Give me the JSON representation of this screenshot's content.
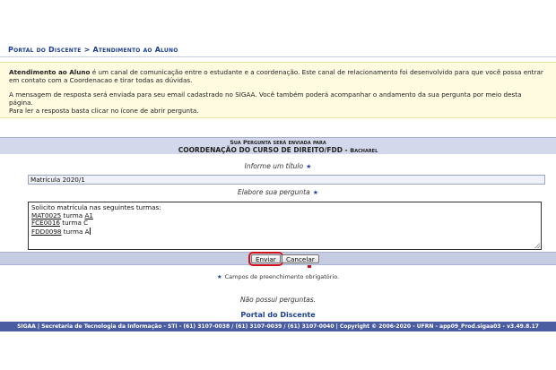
{
  "breadcrumb": {
    "root": "Portal do Discente",
    "separator": ">",
    "current": "Atendimento ao Aluno"
  },
  "info": {
    "lead_bold": "Atendimento ao Aluno",
    "lead_rest": " é um canal de comunicação entre o estudante e a coordenação. Este canal de relacionamento foi desenvolvido para que você possa entrar em contato com a Coordenacao e tirar todas as dúvidas.",
    "line2": "A mensagem de resposta será enviada para seu email cadastrado no SIGAA. Você também poderá acompanhar o andamento da sua pergunta por meio desta página.",
    "line3": "Para ler a resposta basta clicar no ícone de abrir pergunta."
  },
  "form": {
    "header_line1": "Sua Pergunta será enviada para",
    "header_course": "COORDENAÇÃO DO CURSO DE DIREITO/FDD",
    "header_sep": " - ",
    "header_degree": "Bacharel",
    "title_label": "Informe um título",
    "title_value": "Matrícula 2020/1",
    "question_label": "Elabore sua pergunta",
    "required_star": "★",
    "message": {
      "intro": "Solicito matrícula nas seguintes turmas:",
      "rows": [
        {
          "code": "MAT0025",
          "mid": " turma ",
          "class": "A1"
        },
        {
          "code": "FCE0016",
          "mid": " turma C",
          "class": ""
        },
        {
          "code": "FDD0098",
          "mid": " turma A",
          "class": ""
        }
      ]
    }
  },
  "buttons": {
    "send": "Enviar",
    "cancel": "Cancelar"
  },
  "required_note": "Campos de preenchimento obrigatório.",
  "no_questions": "Não possui perguntas.",
  "portal_link": "Portal do Discente",
  "footer": "SIGAA | Secretaria de Tecnologia da Informação - STI - (61) 3107-0038 / (61) 3107-0039 / (61) 3107-0040 | Copyright © 2006-2020 - UFRN - app09_Prod.sigaa03 - v3.49.8.17",
  "colors": {
    "link_blue": "#1c3f94",
    "info_bg": "#fefbe0",
    "header_bg": "#d3d8ea",
    "footer_bg": "#4a5da0",
    "highlight_red": "#d0111b"
  }
}
